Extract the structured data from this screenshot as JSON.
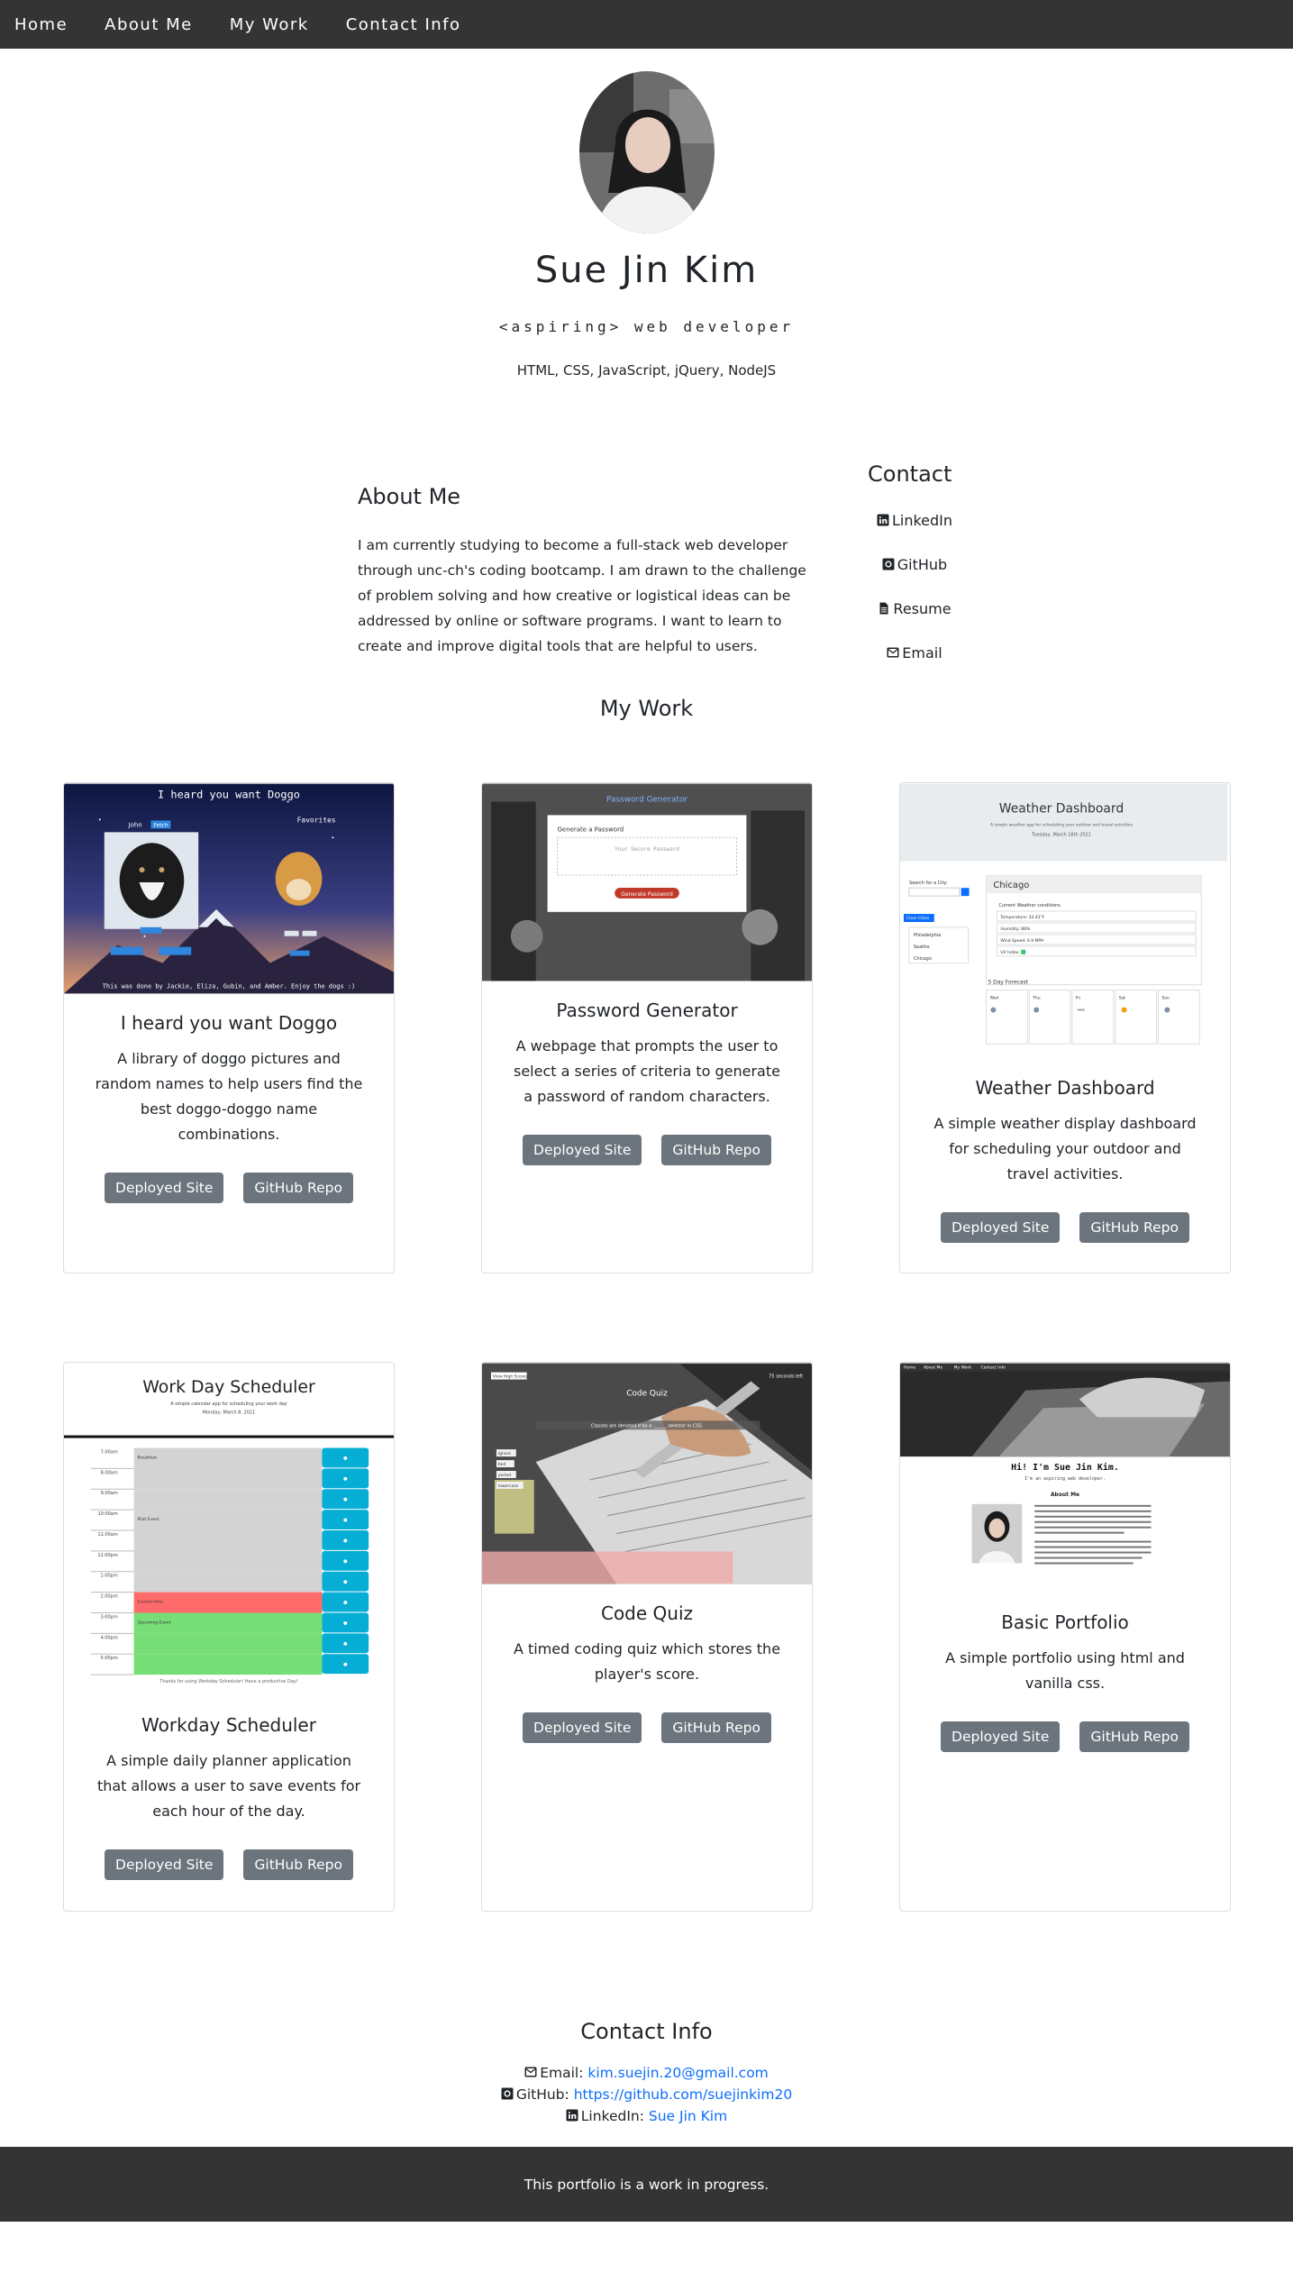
{
  "nav": {
    "items": [
      "Home",
      "About Me",
      "My Work",
      "Contact Info"
    ]
  },
  "hero": {
    "name": "Sue Jin Kim",
    "tagline": "<aspiring> web developer",
    "skills": "HTML, CSS, JavaScript, jQuery, NodeJS"
  },
  "about": {
    "title": "About Me",
    "text": "I am currently studying to become a full-stack web developer through unc-ch's coding bootcamp. I am drawn to the challenge of problem solving and how creative or logistical ideas can be addressed by online or software programs. I want to learn to create and improve digital tools that are helpful to users."
  },
  "contact": {
    "title": "Contact",
    "links": [
      {
        "label": "LinkedIn",
        "icon": "linkedin-icon"
      },
      {
        "label": "GitHub",
        "icon": "github-icon"
      },
      {
        "label": "Resume",
        "icon": "file-icon"
      },
      {
        "label": "Email",
        "icon": "envelope-icon"
      }
    ]
  },
  "work": {
    "title": "My Work",
    "deployed_label": "Deployed Site",
    "repo_label": "GitHub Repo",
    "projects": [
      {
        "title": "I heard you want Doggo",
        "description": "A library of doggo pictures and random names to help users find the best doggo-doggo name combinations.",
        "thumb": {
          "heading": "I heard you want Doggo",
          "name_label": "John",
          "name_button": "Fetch",
          "favorites": "Favorites",
          "footer": "This was done by Jackie, Eliza, Gubin, and Amber. Enjoy the dogs :)"
        }
      },
      {
        "title": "Password Generator",
        "description": "A webpage that prompts the user to select a series of criteria to generate a password of random characters.",
        "thumb": {
          "heading": "Password Generator",
          "box_title": "Generate a Password",
          "placeholder": "Your Secure Password",
          "button": "Generate Password"
        }
      },
      {
        "title": "Weather Dashboard",
        "description": "A simple weather display dashboard for scheduling your outdoor and travel activities.",
        "thumb": {
          "heading": "Weather Dashboard",
          "subtitle": "A simple weather app for scheduling your outdoor and travel activities",
          "date": "Tuesday, March 16th 2021",
          "search_label": "Search for a City:",
          "clear": "Clear Cities",
          "cities": [
            "Philadelphia",
            "Seattle",
            "Chicago"
          ],
          "city": "Chicago",
          "current_label": "Current Weather conditions",
          "stats": [
            "Temperature: 33.43°F",
            "Humidity: 88%",
            "Wind Speed: 6.9 MPH",
            "UV Index"
          ],
          "forecast_title": "5 Day Forecast",
          "days": [
            "Wed",
            "Thu",
            "Fri",
            "Sat",
            "Sun"
          ]
        }
      },
      {
        "title": "Workday Scheduler",
        "description": "A simple daily planner application that allows a user to save events for each hour of the day.",
        "thumb": {
          "heading": "Work Day Scheduler",
          "subtitle": "A simple calendar app for scheduling your work day",
          "date": "Monday, March 8, 2021",
          "hours": [
            "7:00am",
            "8:00am",
            "9:00am",
            "10:00am",
            "11:00am",
            "12:00pm",
            "1:00pm",
            "2:00pm",
            "3:00pm",
            "4:00pm",
            "5:00pm"
          ],
          "events": [
            "Breakfast",
            "",
            "",
            "Pilot Event",
            "",
            "",
            "",
            "Current time",
            "Upcoming Event",
            "",
            ""
          ],
          "footer": "Thanks for using Workday Scheduler! Have a productive Day!"
        }
      },
      {
        "title": "Code Quiz",
        "description": "A timed coding quiz which stores the player's score.",
        "thumb": {
          "high_scores": "View High Scores",
          "heading": "Code Quiz",
          "timer": "75 seconds left",
          "question": "Classes are denoted if by a ______ selector in CSS.",
          "options": [
            "Ignore",
            "bed",
            "period",
            "lowercase"
          ]
        }
      },
      {
        "title": "Basic Portfolio",
        "description": "A simple portfolio using html and vanilla css.",
        "thumb": {
          "nav": [
            "Home",
            "About Me",
            "My Work",
            "Contact Info"
          ],
          "heading": "Hi! I'm Sue Jin Kim.",
          "tagline": "I'm an aspiring web developer.",
          "about_title": "About Me"
        }
      }
    ]
  },
  "contact_info": {
    "title": "Contact Info",
    "email_label": "Email:",
    "email": "kim.suejin.20@gmail.com",
    "github_label": "GitHub:",
    "github": "https://github.com/suejinkim20",
    "linkedin_label": "LinkedIn:",
    "linkedin": "Sue Jin Kim"
  },
  "footer": {
    "text": "This portfolio is a work in progress."
  },
  "colors": {
    "nav_bg": "#343434",
    "button_bg": "#6c757d",
    "link": "#0d6efd"
  }
}
